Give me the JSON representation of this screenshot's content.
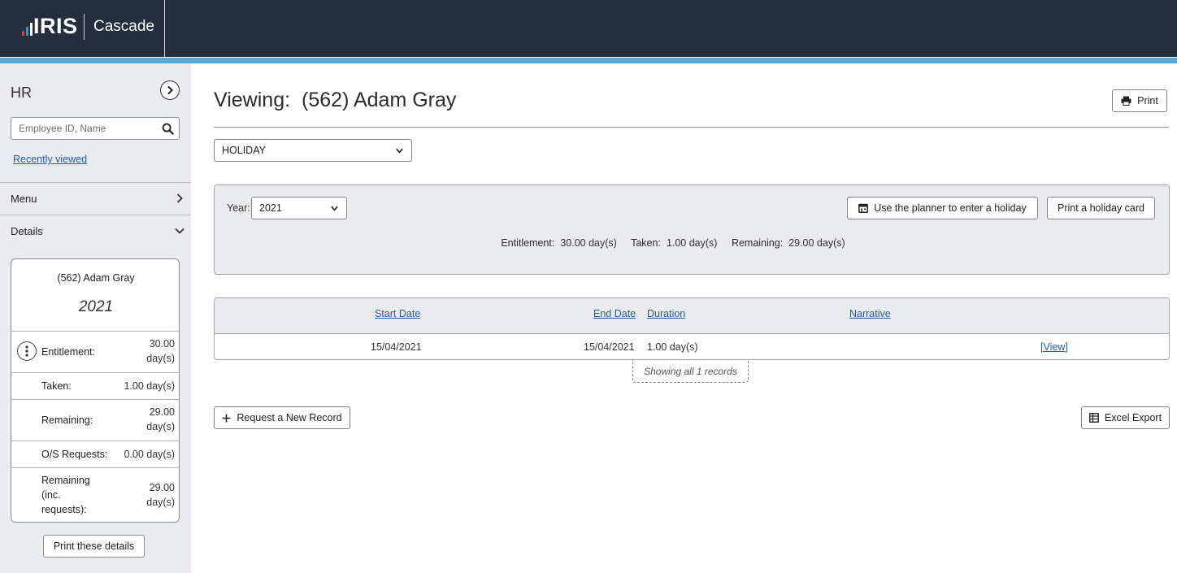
{
  "header": {
    "logo_text": "IRIS",
    "product": "Cascade",
    "logo_bar_colors": [
      "#e03a3a",
      "#3a8fd8",
      "#ffffff"
    ]
  },
  "sidebar": {
    "title": "HR",
    "search_placeholder": "Employee ID, Name",
    "recently_viewed": "Recently viewed",
    "menu_label": "Menu",
    "details_label": "Details",
    "card": {
      "name": "(562) Adam Gray",
      "year": "2021",
      "rows": [
        {
          "key": "Entitlement:",
          "value": "30.00\nday(s)"
        },
        {
          "key": "Taken:",
          "value": "1.00 day(s)"
        },
        {
          "key": "Remaining:",
          "value": "29.00\nday(s)"
        },
        {
          "key": "O/S Requests:",
          "value": "0.00 day(s)"
        },
        {
          "key": "Remaining\n(inc.\nrequests):",
          "value": "29.00\nday(s)"
        }
      ]
    },
    "print_details": "Print these details"
  },
  "main": {
    "viewing_label": "Viewing:",
    "employee": "(562) Adam Gray",
    "print_label": "Print",
    "absence_type": "HOLIDAY",
    "year_label": "Year:",
    "year_value": "2021",
    "planner_button": "Use the planner to enter a holiday",
    "holiday_card_button": "Print a holiday card",
    "summary": {
      "entitlement_label": "Entitlement:",
      "entitlement_value": "30.00 day(s)",
      "taken_label": "Taken:",
      "taken_value": "1.00 day(s)",
      "remaining_label": "Remaining:",
      "remaining_value": "29.00 day(s)"
    },
    "table": {
      "headers": {
        "start": "Start Date",
        "end": "End Date",
        "duration": "Duration",
        "narrative": "Narrative"
      },
      "rows": [
        {
          "start": "15/04/2021",
          "end": "15/04/2021",
          "duration": "1.00 day(s)",
          "narrative": "",
          "action": "[View]"
        }
      ]
    },
    "showing": "Showing all 1 records",
    "request_button": "Request a New Record",
    "excel_button": "Excel Export"
  }
}
